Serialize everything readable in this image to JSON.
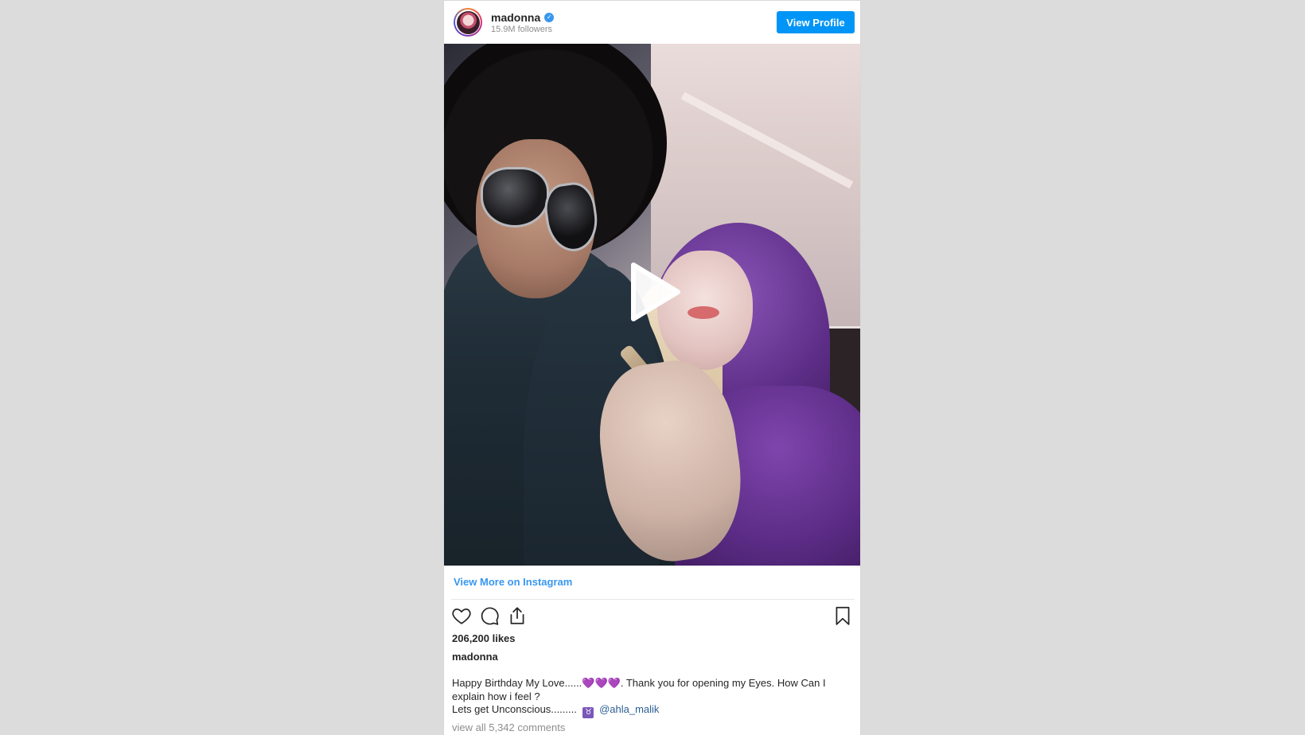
{
  "header": {
    "username": "madonna",
    "verified_mark": "✓",
    "followers": "15.9M followers",
    "view_profile_label": "View Profile"
  },
  "media": {
    "play_icon": "play-icon"
  },
  "view_more_label": "View More on Instagram",
  "actions": {
    "like_icon": "heart-icon",
    "comment_icon": "comment-icon",
    "share_icon": "share-icon",
    "save_icon": "bookmark-icon"
  },
  "likes": "206,200 likes",
  "caption": {
    "username": "madonna",
    "line1_a": "Happy Birthday My Love......",
    "hearts": "💜💜💜",
    "line1_b": ". Thank you for opening my Eyes. How Can I explain how i feel ?",
    "line2_a": "Lets get Unconscious.........",
    "taurus": "♉",
    "mention": "@ahla_malik"
  },
  "comments_link": "view all 5,342 comments",
  "colors": {
    "accent": "#0095f6",
    "link": "#3897f0",
    "background": "#dcdcdc"
  }
}
